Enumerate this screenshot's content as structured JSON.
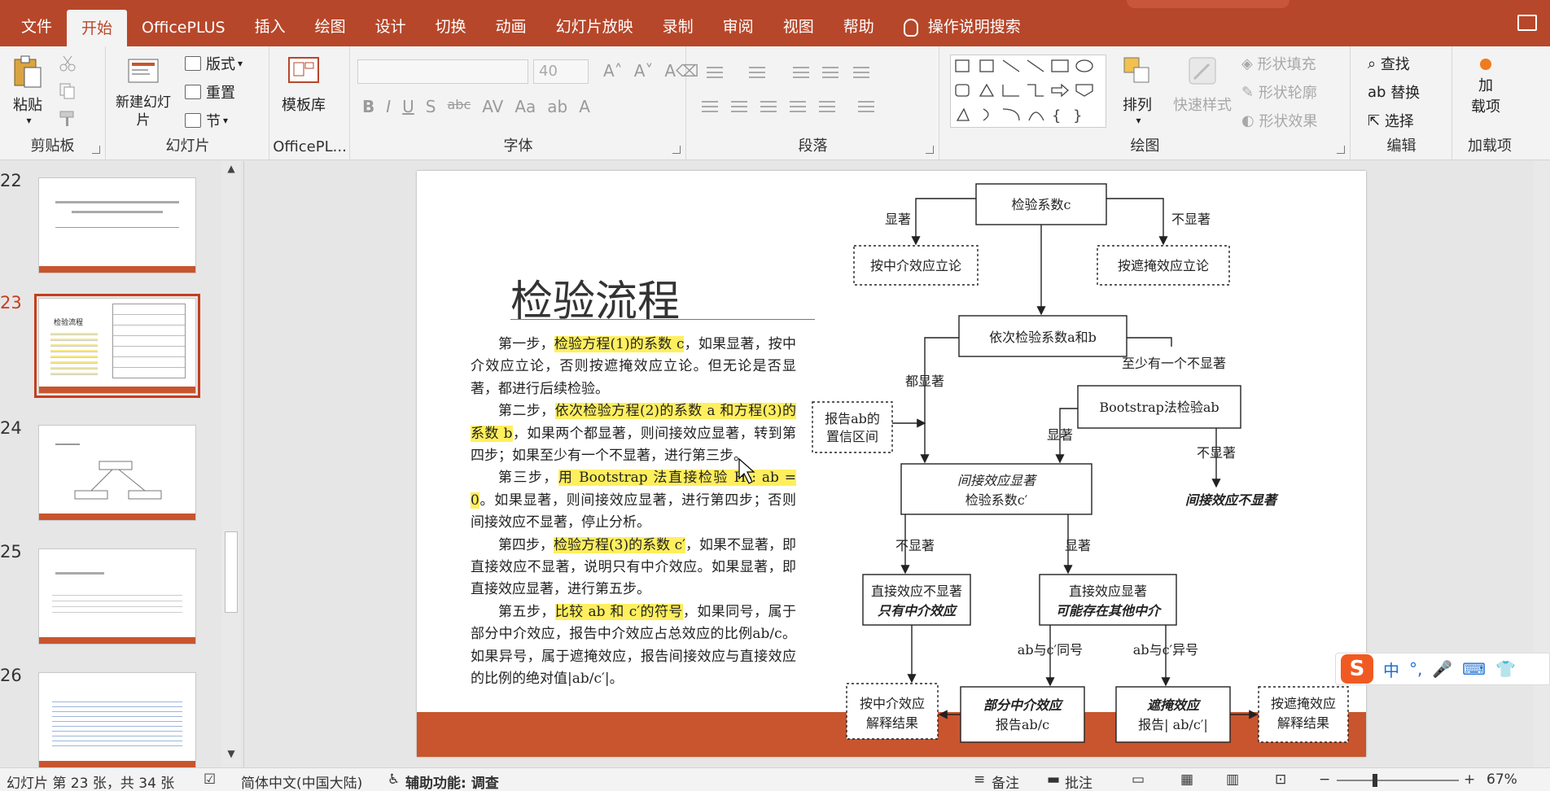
{
  "menu": {
    "items": [
      "文件",
      "开始",
      "OfficePLUS",
      "插入",
      "绘图",
      "设计",
      "切换",
      "动画",
      "幻灯片放映",
      "录制",
      "审阅",
      "视图",
      "帮助"
    ],
    "active": "开始",
    "search": "操作说明搜索"
  },
  "ribbon": {
    "clipboard": {
      "label": "剪贴板",
      "paste": "粘贴"
    },
    "slides": {
      "label": "幻灯片",
      "new_slide": "新建幻灯片",
      "layout": "版式",
      "reset": "重置",
      "section": "节"
    },
    "officeplus": {
      "label": "OfficePL...",
      "templates": "模板库"
    },
    "font": {
      "label": "字体",
      "size": "40"
    },
    "paragraph": {
      "label": "段落"
    },
    "drawing": {
      "label": "绘图",
      "arrange": "排列",
      "quick_styles": "快速样式",
      "shape_fill": "形状填充",
      "shape_outline": "形状轮廓",
      "shape_effects": "形状效果"
    },
    "editing": {
      "label": "编辑",
      "find": "查找",
      "replace": "替换",
      "select": "选择"
    },
    "addins": {
      "label": "加载项",
      "addins_btn_1": "加",
      "addins_btn_2": "载项"
    }
  },
  "thumbnails": [
    {
      "num": "22",
      "selected": false
    },
    {
      "num": "23",
      "selected": true
    },
    {
      "num": "24",
      "selected": false
    },
    {
      "num": "25",
      "selected": false
    },
    {
      "num": "26",
      "selected": false
    }
  ],
  "slide": {
    "title": "检验流程",
    "paragraphs": {
      "p1_a": "第一步，",
      "p1_h": "检验方程(1)的系数 c",
      "p1_b": "，如果显著，按中介效应立论，否则按遮掩效应立论。但无论是否显著，都进行后续检验。",
      "p2_a": "第二步，",
      "p2_h": "依次检验方程(2)的系数 a 和方程(3)的系数 b",
      "p2_b": "，如果两个都显著，则间接效应显著，转到第四步；如果至少有一个不显著，进行第三步。",
      "p3_a": "第三步，",
      "p3_h": "用 Bootstrap 法直接检验 H₀: ab = 0",
      "p3_b": "。如果显著，则间接效应显著，进行第四步；否则间接效应不显著，停止分析。",
      "p4_a": "第四步，",
      "p4_h": "检验方程(3)的系数 c′",
      "p4_b": "，如果不显著，即直接效应不显著，说明只有中介效应。如果显著，即直接效应显著，进行第五步。",
      "p5_a": "第五步，",
      "p5_h": "比较 ab 和 c′的符号",
      "p5_b": "，如果同号，属于部分中介效应，报告中介效应占总效应的比例ab/c。如果异号，属于遮掩效应，报告间接效应与直接效应的比例的绝对值|ab/c′|。"
    },
    "flow": {
      "n1": "检验系数c",
      "l_sig": "显著",
      "l_nonsig": "不显著",
      "n2": "按中介效应立论",
      "n3": "按遮掩效应立论",
      "n4": "依次检验系数a和b",
      "l_both": "都显著",
      "l_atleast": "至少有一个不显著",
      "n5_1": "报告ab的",
      "n5_2": "置信区间",
      "n6": "Bootstrap法检验ab",
      "l_sig2": "显著",
      "l_nonsig2": "不显著",
      "n7_1": "间接效应显著",
      "n7_2": "检验系数c′",
      "n8": "间接效应不显著",
      "l_nonsig3": "不显著",
      "l_sig3": "显著",
      "n9_1": "直接效应不显著",
      "n9_2": "只有中介效应",
      "n10_1": "直接效应显著",
      "n10_2": "可能存在其他中介",
      "l_same": "ab与c′同号",
      "l_diff": "ab与c′异号",
      "n11_1": "按中介效应",
      "n11_2": "解释结果",
      "n12_1": "部分中介效应",
      "n12_2": "报告ab/c",
      "n13_1": "遮掩效应",
      "n13_2": "报告| ab/c′|",
      "n14_1": "按遮掩效应",
      "n14_2": "解释结果"
    }
  },
  "status": {
    "slide_count": "幻灯片 第 23 张，共 34 张",
    "language": "简体中文(中国大陆)",
    "accessibility": "辅助功能: 调查",
    "notes": "备注",
    "comments": "批注",
    "zoom": "67%"
  },
  "ime": {
    "zh": "中"
  },
  "colors": {
    "accent": "#b7472a",
    "slide_bar": "#c8552e",
    "highlight": "#ffef5e"
  }
}
